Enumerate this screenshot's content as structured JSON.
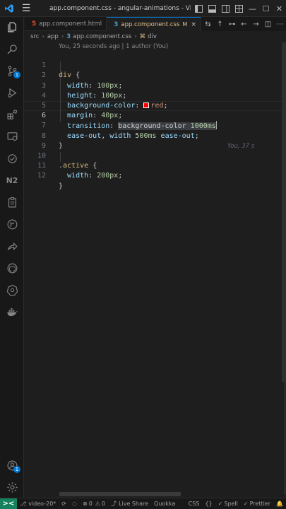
{
  "window": {
    "title": "app.component.css - angular-animations - Visual St..."
  },
  "tabs": [
    {
      "icon": "5",
      "label": "app.component.html",
      "active": false
    },
    {
      "icon": "3",
      "label": "app.component.css",
      "modified": "M",
      "active": true,
      "close": "×"
    }
  ],
  "breadcrumb": {
    "parts": [
      "src",
      "app"
    ],
    "file": "app.component.css",
    "symbol": "div"
  },
  "editor": {
    "codelens": "You, 25 seconds ago | 1 author (You)",
    "blame": "You, 37 s",
    "lines": [
      {
        "n": "1"
      },
      {
        "n": "2"
      },
      {
        "n": "3"
      },
      {
        "n": "4"
      },
      {
        "n": "5"
      },
      {
        "n": "6"
      },
      {
        "n": "7"
      },
      {
        "n": "8"
      },
      {
        "n": "9"
      },
      {
        "n": "10"
      },
      {
        "n": "11"
      },
      {
        "n": "12"
      }
    ],
    "code": {
      "l1_sel": "div",
      "l1_brace": "{",
      "l2_prop": "width",
      "l2_val": "100px",
      "l3_prop": "height",
      "l3_val": "100px",
      "l4_prop": "background-color",
      "l4_val": "red",
      "l5_prop": "margin",
      "l5_val": "40px",
      "l6_prop": "transition",
      "l6_v1": "background-color",
      "l6_v2": "1000ms",
      "l7_v1": "ease-out",
      "l7_v2": "width",
      "l7_v3": "500ms",
      "l7_v4": "ease-out",
      "l8_brace": "}",
      "l10_sel": ".active",
      "l10_brace": "{",
      "l11_prop": "width",
      "l11_val": "200px",
      "l12_brace": "}"
    }
  },
  "statusbar": {
    "remote": "><",
    "branch": "video-20*",
    "errors": "0",
    "warnings": "0",
    "live_share": "Live Share",
    "quokka": "Quokka",
    "language": "CSS",
    "spell": "Spell",
    "prettier": "Prettier"
  },
  "badges": {
    "scm": "1",
    "accounts": "1"
  },
  "colors": {
    "accent": "#0078d4",
    "remote": "#16825d",
    "swatch": "#ff0000"
  }
}
